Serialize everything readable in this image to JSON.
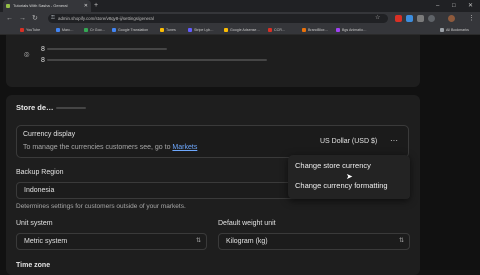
{
  "browser": {
    "tab_title": "Tutorials With Sasha - General",
    "tab_close": "✕",
    "new_tab": "+",
    "url": "admin.shopify.com/store/v8qy8-ij/settings/general",
    "back": "←",
    "forward": "→",
    "reload": "↻",
    "star": "☆",
    "menu": "⋮",
    "win_min": "–",
    "win_max": "□",
    "win_close": "✕",
    "bookmarks": [
      "YouTube",
      "Marc…",
      "Cr Goo…",
      "Google Translation",
      "Tunes",
      "Stripe Lyb…",
      "Google Adsense…",
      "CCR…",
      "BrandBlox…",
      "Bgs Animatio…"
    ],
    "bookmarks_all": "All Bookmarks"
  },
  "address_card": {
    "line1": "8",
    "line2": "8"
  },
  "store_defaults": {
    "heading": "Store de…",
    "currency_title": "Currency display",
    "currency_desc": "To manage the currencies customers see, go to",
    "currency_link": "Markets",
    "currency_value": "US Dollar (USD $)",
    "more": "···",
    "backup_label": "Backup Region",
    "backup_value": "Indonesia",
    "backup_help": "Determines settings for customers outside of your markets.",
    "unit_label": "Unit system",
    "unit_value": "Metric system",
    "weight_label": "Default weight unit",
    "weight_value": "Kilogram (kg)",
    "timezone_label": "Time zone",
    "select_arrow": "⇅"
  },
  "menu": {
    "item1": "Change store currency",
    "item2": "Change currency formatting"
  }
}
